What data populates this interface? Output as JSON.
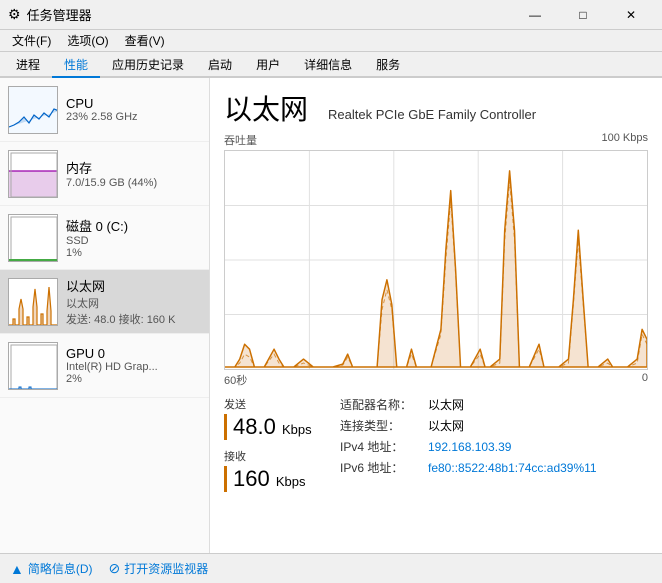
{
  "titleBar": {
    "icon": "⚙",
    "title": "任务管理器",
    "minimizeLabel": "—",
    "maximizeLabel": "□",
    "closeLabel": "✕"
  },
  "menuBar": {
    "items": [
      "文件(F)",
      "选项(O)",
      "查看(V)"
    ]
  },
  "tabs": [
    {
      "label": "进程",
      "active": false
    },
    {
      "label": "性能",
      "active": true
    },
    {
      "label": "应用历史记录",
      "active": false
    },
    {
      "label": "启动",
      "active": false
    },
    {
      "label": "用户",
      "active": false
    },
    {
      "label": "详细信息",
      "active": false
    },
    {
      "label": "服务",
      "active": false
    }
  ],
  "sidebar": {
    "items": [
      {
        "id": "cpu",
        "name": "CPU",
        "detail1": "23% 2.58 GHz",
        "detail2": "",
        "active": false,
        "chartType": "cpu"
      },
      {
        "id": "memory",
        "name": "内存",
        "detail1": "7.0/15.9 GB (44%)",
        "detail2": "",
        "active": false,
        "chartType": "memory"
      },
      {
        "id": "disk",
        "name": "磁盘 0 (C:)",
        "detail1": "SSD",
        "detail2": "1%",
        "active": false,
        "chartType": "disk"
      },
      {
        "id": "ethernet",
        "name": "以太网",
        "detail1": "以太网",
        "detail2": "发送: 48.0  接收: 160 K",
        "active": true,
        "chartType": "ethernet"
      },
      {
        "id": "gpu",
        "name": "GPU 0",
        "detail1": "Intel(R) HD Grap...",
        "detail2": "2%",
        "active": false,
        "chartType": "gpu"
      }
    ]
  },
  "mainPanel": {
    "title": "以太网",
    "subtitle": "Realtek PCIe GbE Family Controller",
    "chartLabels": {
      "left": "吞吐量",
      "right": "100 Kbps"
    },
    "chartTime": {
      "left": "60秒",
      "right": "0"
    },
    "stats": {
      "send": {
        "label": "发送",
        "value": "48.0",
        "unit": "Kbps"
      },
      "recv": {
        "label": "接收",
        "value": "160",
        "unit": "Kbps"
      }
    },
    "info": {
      "adapterLabel": "适配器名称：",
      "adapterVal": "以太网",
      "connTypeLabel": "连接类型：",
      "connTypeVal": "以太网",
      "ipv4Label": "IPv4 地址：",
      "ipv4Val": "192.168.103.39",
      "ipv6Label": "IPv6 地址：",
      "ipv6Val": "fe80::8522:48b1:74cc:ad39%11"
    }
  },
  "bottomBar": {
    "collapseLabel": "简略信息(D)",
    "monitorLabel": "打开资源监视器"
  }
}
